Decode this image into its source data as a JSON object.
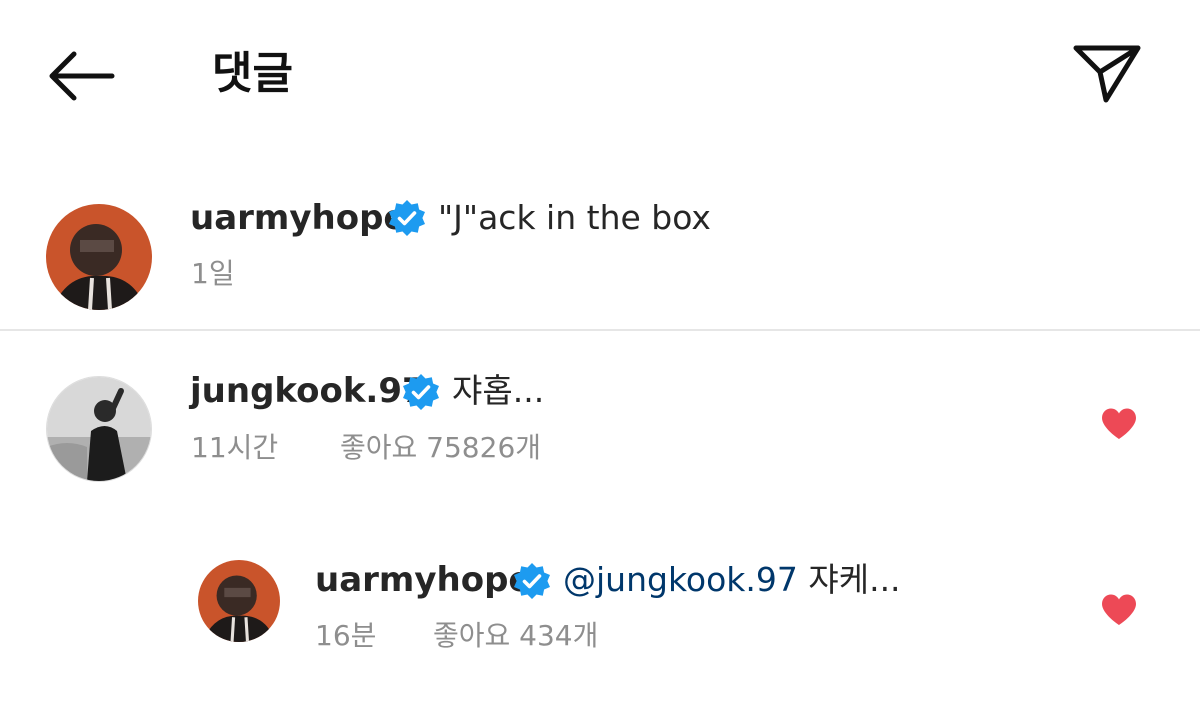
{
  "header": {
    "title": "댓글",
    "back_icon": "arrow-left-icon",
    "share_icon": "paper-plane-icon"
  },
  "caption": {
    "username": "uarmyhope",
    "text": "\"J\"ack in the box",
    "time": "1일"
  },
  "comments": [
    {
      "username": "jungkook.97",
      "text": "쟈홉...",
      "time": "11시간",
      "likes": "좋아요 75826개",
      "liked": true
    },
    {
      "username": "uarmyhope",
      "mention": "@jungkook.97",
      "text": "쟈케...",
      "time": "16분",
      "likes": "좋아요 434개",
      "liked": true
    }
  ],
  "colors": {
    "verified": "#1d9bf0",
    "heart": "#ed4956",
    "mention": "#00376b",
    "meta": "#8e8e8e"
  }
}
